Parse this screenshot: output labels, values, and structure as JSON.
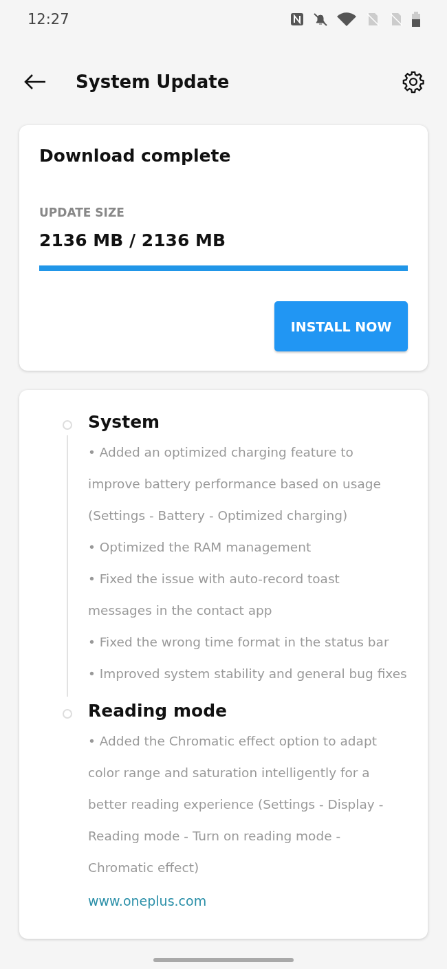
{
  "status_bar": {
    "time": "12:27"
  },
  "header": {
    "title": "System Update"
  },
  "download": {
    "title": "Download complete",
    "size_label": "UPDATE SIZE",
    "size_value": "2136 MB / 2136 MB",
    "progress": {
      "level": 1
    },
    "button": "INSTALL NOW"
  },
  "changelog": {
    "sections": [
      {
        "title": "System",
        "items": [
          "• Added an optimized charging feature to improve battery performance based on usage (Settings - Battery - Optimized charging)",
          "• Optimized the RAM management",
          "• Fixed the issue with auto-record toast messages in the contact app",
          "• Fixed the wrong time format in the status bar",
          "• Improved system stability and general bug fixes"
        ]
      },
      {
        "title": "Reading mode",
        "items": [
          "• Added the Chromatic effect option to adapt color range and saturation intelligently for a better reading experience (Settings - Display - Reading mode - Turn on reading mode - Chromatic effect)"
        ]
      }
    ],
    "link": "www.oneplus.com"
  }
}
